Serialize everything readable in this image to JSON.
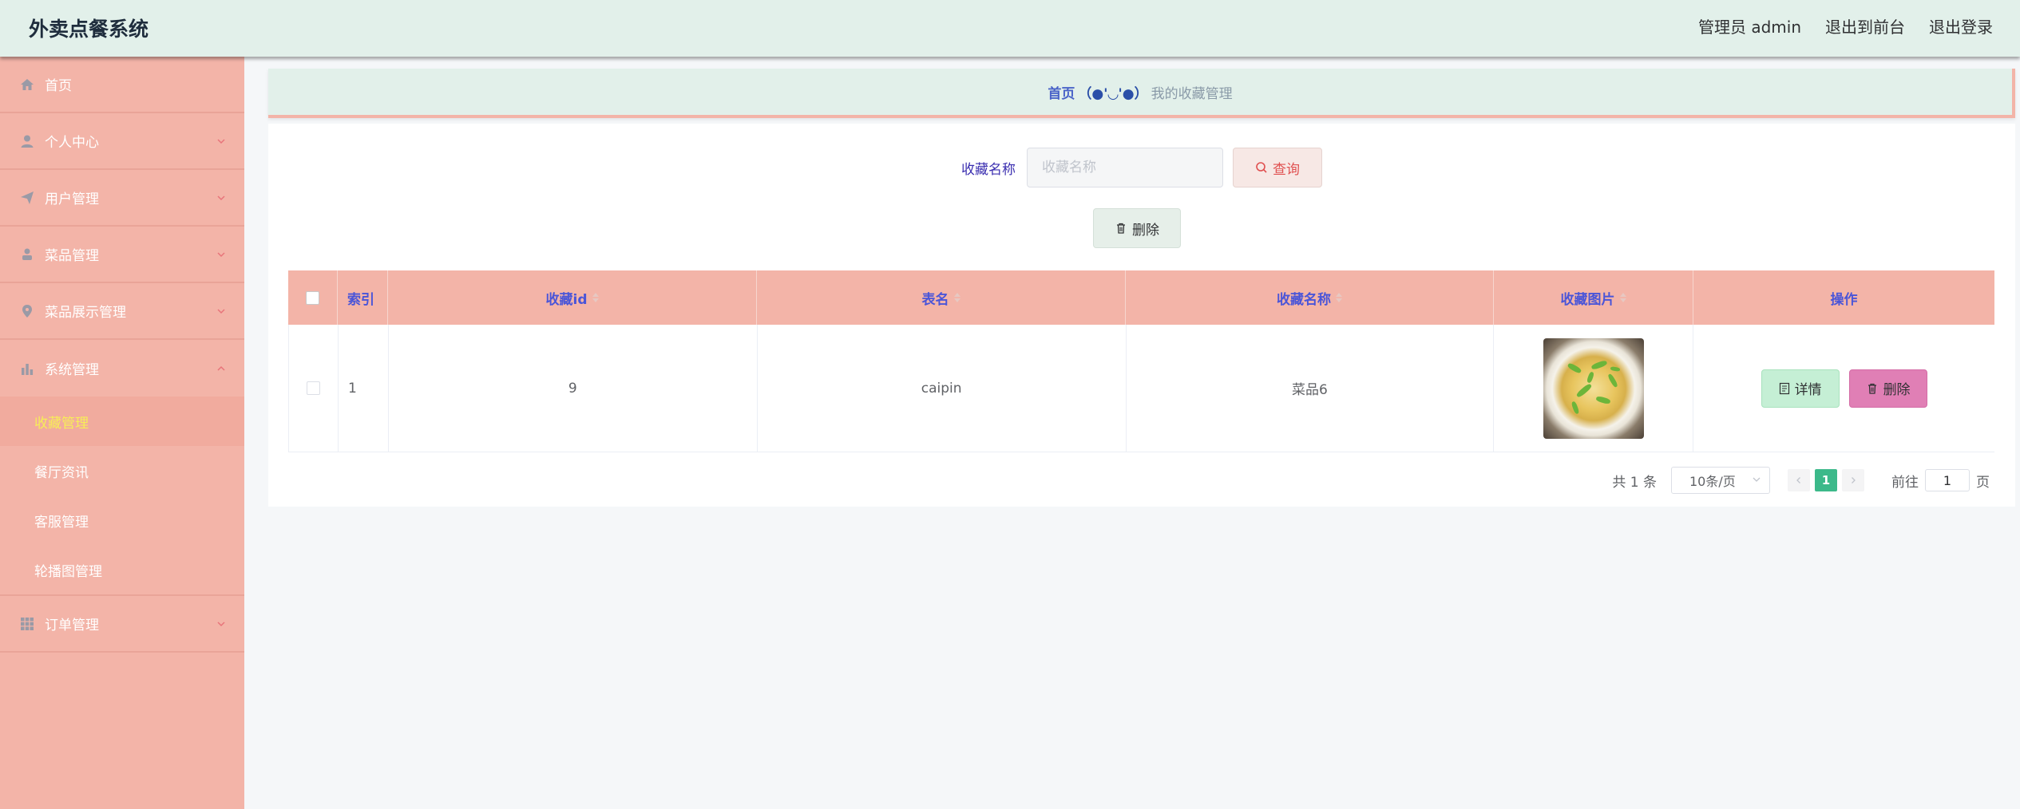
{
  "header": {
    "title": "外卖点餐系统",
    "user_label": "管理员 admin",
    "to_front_label": "退出到前台",
    "logout_label": "退出登录"
  },
  "sidebar": {
    "items": [
      {
        "label": "首页",
        "icon": "home-icon"
      },
      {
        "label": "个人中心",
        "icon": "user-icon"
      },
      {
        "label": "用户管理",
        "icon": "paper-plane-icon"
      },
      {
        "label": "菜品管理",
        "icon": "person-icon"
      },
      {
        "label": "菜品展示管理",
        "icon": "location-icon"
      },
      {
        "label": "系统管理",
        "icon": "bar-chart-icon"
      },
      {
        "label": "订单管理",
        "icon": "grid-icon"
      }
    ],
    "system_sub": [
      {
        "label": "收藏管理"
      },
      {
        "label": "餐厅资讯"
      },
      {
        "label": "客服管理"
      },
      {
        "label": "轮播图管理"
      }
    ]
  },
  "breadcrumb": {
    "home": "首页",
    "face": "（●'◡'●）",
    "current": "我的收藏管理"
  },
  "search": {
    "label": "收藏名称",
    "placeholder": "收藏名称",
    "button_label": "查询"
  },
  "toolbar": {
    "delete_label": "删除"
  },
  "table": {
    "columns": [
      "索引",
      "收藏id",
      "表名",
      "收藏名称",
      "收藏图片",
      "操作"
    ],
    "rows": [
      {
        "index": "1",
        "id": "9",
        "table_name": "caipin",
        "name": "菜品6",
        "detail_label": "详情",
        "delete_label": "删除"
      }
    ]
  },
  "pagination": {
    "total": "共 1 条",
    "page_size": "10条/页",
    "current_page": "1",
    "goto_label": "前往",
    "goto_value": "1",
    "page_suffix": "页"
  },
  "colors": {
    "header_bg": "#e2f0ea",
    "sidebar_bg": "#f3b4a8",
    "active_sub": "#f7ee57",
    "table_head": "#f3b4a8",
    "pager_active": "#3cb98a"
  }
}
